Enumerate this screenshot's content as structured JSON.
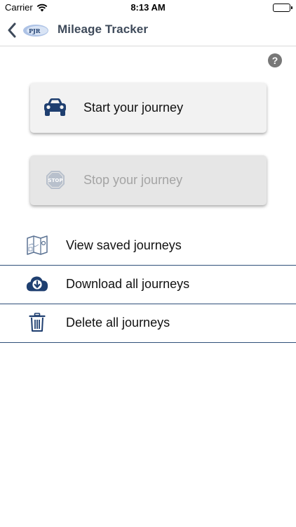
{
  "status_bar": {
    "carrier": "Carrier",
    "time": "8:13 AM"
  },
  "nav": {
    "logo_text": "PJR",
    "title": "Mileage Tracker"
  },
  "help": {
    "label": "?"
  },
  "journey_buttons": {
    "start_label": "Start your journey",
    "stop_label": "Stop your journey",
    "stop_icon_text": "STOP"
  },
  "menu": {
    "items": [
      {
        "label": "View saved journeys",
        "icon": "map-icon"
      },
      {
        "label": "Download all journeys",
        "icon": "cloud-download-icon"
      },
      {
        "label": "Delete all journeys",
        "icon": "trash-icon"
      }
    ]
  },
  "colors": {
    "brand_navy": "#1f3f70",
    "divider": "#2f4f79",
    "disabled_text": "#a4a4a4"
  }
}
